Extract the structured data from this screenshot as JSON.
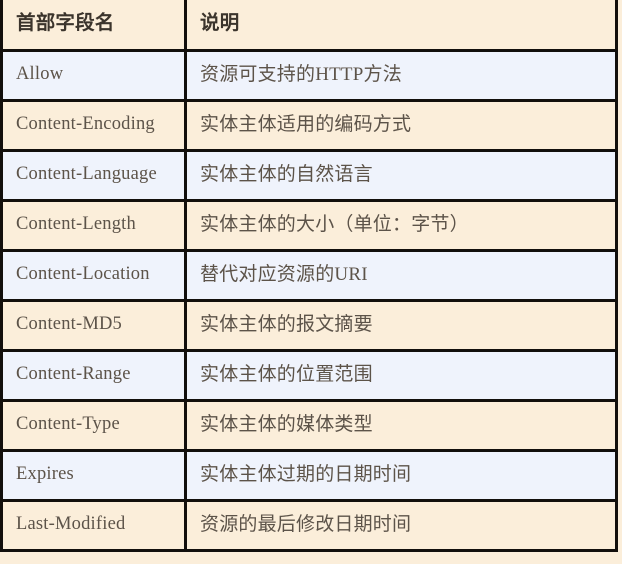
{
  "table": {
    "columns": [
      {
        "key": "field",
        "label": "首部字段名"
      },
      {
        "key": "description",
        "label": "说明"
      }
    ],
    "rows": [
      {
        "field": "Allow",
        "description": "资源可支持的HTTP方法"
      },
      {
        "field": "Content-Encoding",
        "description": "实体主体适用的编码方式"
      },
      {
        "field": "Content-Language",
        "description": "实体主体的自然语言"
      },
      {
        "field": "Content-Length",
        "description": "实体主体的大小（单位：字节）"
      },
      {
        "field": "Content-Location",
        "description": "替代对应资源的URI"
      },
      {
        "field": "Content-MD5",
        "description": "实体主体的报文摘要"
      },
      {
        "field": "Content-Range",
        "description": "实体主体的位置范围"
      },
      {
        "field": "Content-Type",
        "description": "实体主体的媒体类型"
      },
      {
        "field": "Expires",
        "description": "实体主体过期的日期时间"
      },
      {
        "field": "Last-Modified",
        "description": "资源的最后修改日期时间"
      }
    ]
  },
  "style": {
    "header_background": "#fbeeda",
    "row_background_odd": "#eff3fc",
    "row_background_even": "#fbeeda",
    "border_color": "#120f0c",
    "text_color": "#5c5349",
    "header_text_color": "#3b342c"
  }
}
